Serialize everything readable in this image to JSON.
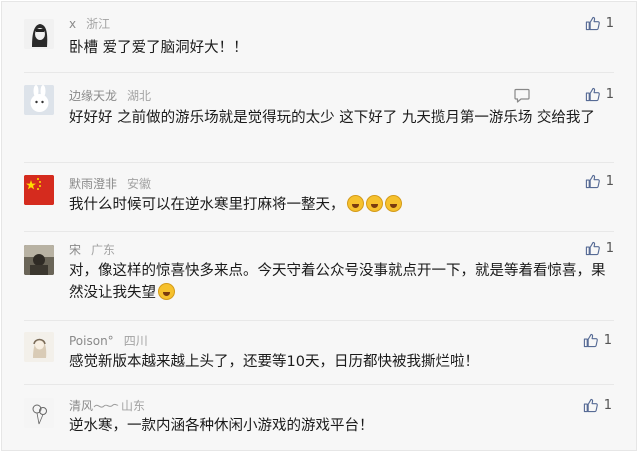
{
  "comments": [
    {
      "user": "x",
      "location": "浙江",
      "text": "卧槽 爱了爱了脑洞好大！！",
      "likes": "1",
      "avatar_icon": "sketch-portrait-avatar"
    },
    {
      "user": "边缘天龙",
      "location": "湖北",
      "text": "好好好 之前做的游乐场就是觉得玩的太少 这下好了 九天揽月第一游乐场 交给我了",
      "likes": "1",
      "avatar_icon": "white-rabbit-avatar"
    },
    {
      "user": "默雨澄非",
      "location": "安徽",
      "text": "我什么时候可以在逆水寒里打麻将一整天，",
      "emoji_count": 3,
      "likes": "1",
      "avatar_icon": "red-flag-avatar"
    },
    {
      "user": "宋",
      "location": "广东",
      "text": "对，像这样的惊喜快多来点。今天守着公众号没事就点开一下，就是等着看惊喜，果然没让我失望",
      "emoji_count": 1,
      "likes": "1",
      "avatar_icon": "photo-avatar"
    },
    {
      "user": "Poison°",
      "location": "四川",
      "text": "感觉新版本越来越上头了，还要等10天，日历都快被我撕烂啦！",
      "likes": "1",
      "avatar_icon": "hand-drawn-avatar"
    },
    {
      "user": "清风",
      "location": "山东",
      "text": "逆水寒，一款内涵各种休闲小游戏的游戏平台！",
      "likes": "1",
      "avatar_icon": "sketch-balloon-avatar"
    }
  ],
  "colors": {
    "background": "#f7f7f7",
    "name": "#8a8a8a",
    "text": "#1a1a1a",
    "like_icon": "#576b95"
  }
}
